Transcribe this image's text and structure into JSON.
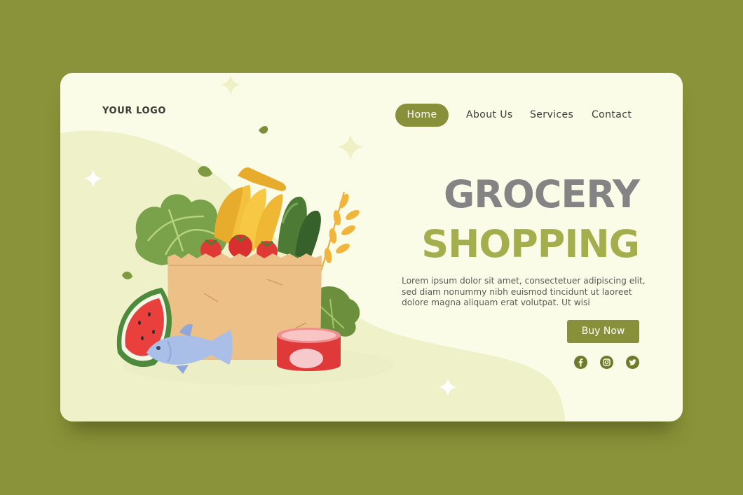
{
  "header": {
    "logo_text": "YOUR LOGO",
    "nav": [
      {
        "label": "Home",
        "active": true
      },
      {
        "label": "About Us",
        "active": false
      },
      {
        "label": "Services",
        "active": false
      },
      {
        "label": "Contact",
        "active": false
      }
    ]
  },
  "hero": {
    "title_line1": "GROCERY",
    "title_line2": "SHOPPING",
    "description": "Lorem ipsum dolor sit amet, consectetuer adipiscing elit, sed diam nonummy nibh euismod tincidunt ut laoreet dolore magna aliquam erat volutpat. Ut wisi",
    "cta_label": "Buy Now"
  },
  "socials": [
    "facebook-icon",
    "instagram-icon",
    "twitter-icon"
  ],
  "colors": {
    "background": "#8a9339",
    "card": "#fbfce8",
    "accent": "#88913a",
    "title_gray": "#858484",
    "title_green": "#a4ae4c"
  }
}
